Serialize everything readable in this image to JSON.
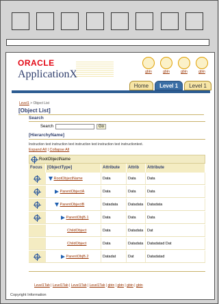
{
  "brand": {
    "oracle": "ORACLE",
    "app_name": "ApplicationX"
  },
  "globals": [
    "gbtn",
    "gbtn",
    "gbtn",
    "gbtn"
  ],
  "tabs": [
    {
      "label": "Home",
      "state": "off"
    },
    {
      "label": "Level 1",
      "state": "on"
    },
    {
      "label": "Level 1",
      "state": "off"
    }
  ],
  "breadcrumb": {
    "link": "Level1",
    "sep": ">",
    "current": "Object List"
  },
  "page_title": "[Object List]",
  "search": {
    "heading": "Search",
    "label": "Search",
    "value": "",
    "go": "Go"
  },
  "hierarchy": {
    "heading": "[HierarchyName]",
    "instruction": "Instruction text instruction text instruction text instruction text instructiontext.",
    "expand_all": "Expand All",
    "separator": "|",
    "collapse_all": "Collapse All",
    "root_label": "RootObjectName",
    "columns": [
      "Focus",
      "[ObjectType]",
      "Attribute",
      "Attrib",
      "Attribute"
    ],
    "rows": [
      {
        "focus": true,
        "toggle": "down",
        "indent": 0,
        "name": "RootObjectName",
        "a1": "Data",
        "a2": "Data",
        "a3": "Data"
      },
      {
        "focus": true,
        "toggle": "right",
        "indent": 1,
        "name": "ParentObjectA",
        "a1": "Data",
        "a2": "Data",
        "a3": "Data"
      },
      {
        "focus": true,
        "toggle": "down",
        "indent": 1,
        "name": "ParentObjectB",
        "a1": "Datadata",
        "a2": "Datadata",
        "a3": "Datadata"
      },
      {
        "focus": true,
        "toggle": "right",
        "indent": 2,
        "name": "ParentObjB.1",
        "a1": "Data",
        "a2": "Data",
        "a3": "Data"
      },
      {
        "focus": false,
        "toggle": "none",
        "indent": 3,
        "name": "ChildObject",
        "a1": "Data",
        "a2": "Datadata",
        "a3": "Dat"
      },
      {
        "focus": false,
        "toggle": "none",
        "indent": 3,
        "name": "ChildObject",
        "a1": "Data",
        "a2": "Datadata",
        "a3": "Datadatad Dat"
      },
      {
        "focus": true,
        "toggle": "right",
        "indent": 2,
        "name": "ParentObjB.2",
        "a1": "Datadat",
        "a2": "Dat",
        "a3": "Datadatad"
      }
    ]
  },
  "footer": [
    "Level1Tab",
    "Level1Tab",
    "Level1Tab",
    "Level1Tab",
    "gbtn",
    "gbtn",
    "gbtn",
    "gbtn"
  ],
  "copyright": "Copyright Information"
}
